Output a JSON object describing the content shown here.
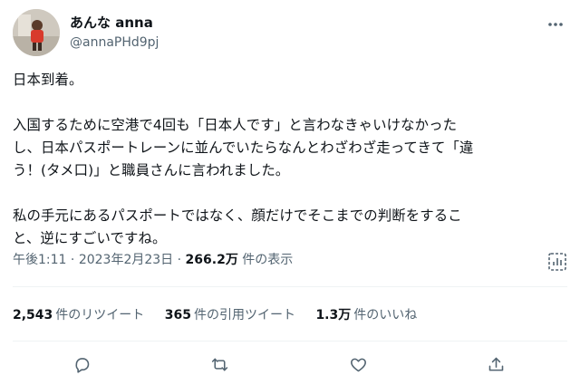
{
  "author": {
    "display_name": "あんな anna",
    "handle": "@annaPHd9pj"
  },
  "tweet": {
    "text": "日本到着。\n\n入国するために空港で4回も「日本人です」と言わなきゃいけなかった\nし、日本パスポートレーンに並んでいたらなんとわざわざ走ってきて「違\nう！(タメ口)」と職員さんに言われました。\n\n私の手元にあるパスポートではなく、顔だけでそこまでの判断をするこ\nと、逆にすごいですね。"
  },
  "meta": {
    "time": "午後1:11",
    "sep1": " · ",
    "date": "2023年2月23日",
    "sep2": " · ",
    "views_count": "266.2万",
    "views_label": " 件の表示"
  },
  "stats": {
    "retweets": {
      "count": "2,543",
      "label": "件のリツイート"
    },
    "quotes": {
      "count": "365",
      "label": "件の引用ツイート"
    },
    "likes": {
      "count": "1.3万",
      "label": "件のいいね"
    }
  },
  "icons": {
    "more": "more-horizontal-icon",
    "analytics": "analytics-icon",
    "reply": "reply-icon",
    "retweet": "retweet-icon",
    "like": "heart-icon",
    "share": "share-icon"
  },
  "colors": {
    "text": "#0f1419",
    "secondary": "#536471",
    "divider": "#eff3f4"
  }
}
